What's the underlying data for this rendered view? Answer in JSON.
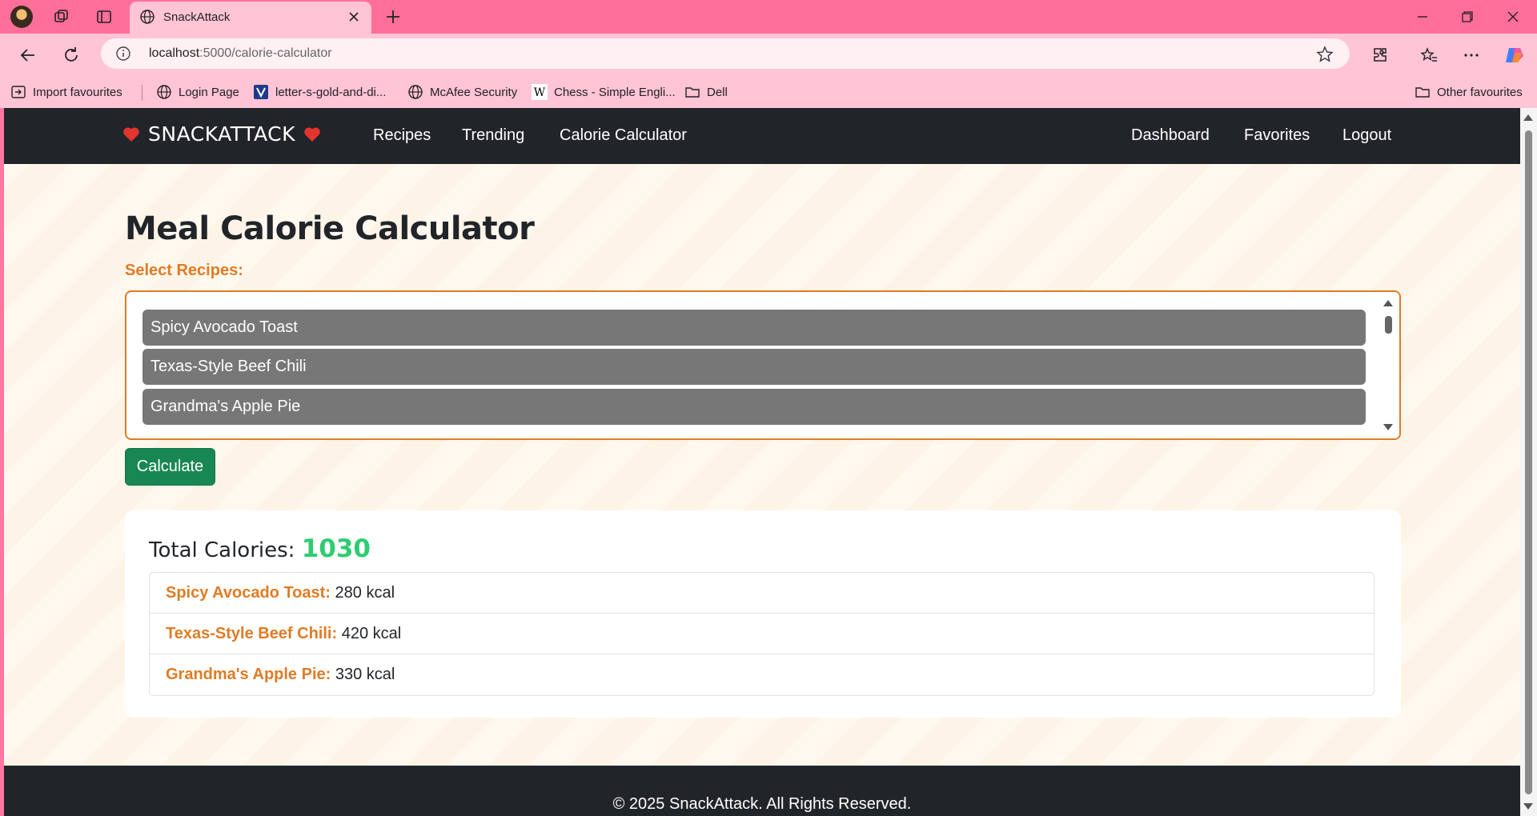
{
  "browser": {
    "tab_title": "SnackAttack",
    "url_host": "localhost",
    "url_path": ":5000/calorie-calculator",
    "favorites": [
      {
        "label": "Import favourites",
        "icon": "import-icon"
      },
      {
        "label": "Login Page",
        "icon": "globe-icon"
      },
      {
        "label": "letter-s-gold-and-di...",
        "icon": "v-logo-icon"
      },
      {
        "label": "McAfee Security",
        "icon": "globe-icon"
      },
      {
        "label": "Chess - Simple Engli...",
        "icon": "wikipedia-icon"
      },
      {
        "label": "Dell",
        "icon": "folder-icon"
      }
    ],
    "other_favorites": "Other favourites"
  },
  "nav": {
    "brand": "SNACKATTACK",
    "links_left": [
      "Recipes",
      "Trending",
      "Calorie Calculator"
    ],
    "links_right": [
      "Dashboard",
      "Favorites",
      "Logout"
    ]
  },
  "main": {
    "heading": "Meal Calorie Calculator",
    "select_label": "Select Recipes:",
    "options": [
      "Spicy Avocado Toast",
      "Texas-Style Beef Chili",
      "Grandma's Apple Pie"
    ],
    "calculate_label": "Calculate"
  },
  "results": {
    "total_label": "Total Calories:",
    "total_value": "1030",
    "items": [
      {
        "name": "Spicy Avocado Toast:",
        "kcal": " 280 kcal"
      },
      {
        "name": "Texas-Style Beef Chili:",
        "kcal": " 420 kcal"
      },
      {
        "name": "Grandma's Apple Pie:",
        "kcal": " 330 kcal"
      }
    ]
  },
  "footer": {
    "copyright": "© 2025 SnackAttack. All Rights Reserved."
  },
  "colors": {
    "accent_orange": "#e07b24",
    "success_green": "#198754",
    "total_green": "#2ecc71",
    "navbar_dark": "#212529",
    "browser_pink": "#ff6f9a"
  }
}
